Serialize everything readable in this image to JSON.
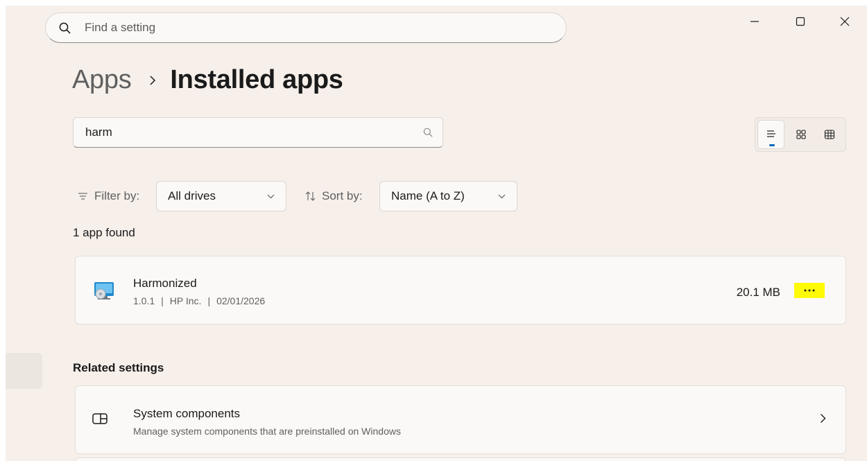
{
  "search": {
    "placeholder": "Find a setting"
  },
  "window_controls": {
    "minimize_icon": "minimize-icon",
    "maximize_icon": "maximize-icon",
    "close_icon": "close-icon"
  },
  "breadcrumb": {
    "parent": "Apps",
    "current": "Installed apps"
  },
  "app_search": {
    "value": "harm",
    "icon": "search-icon"
  },
  "view_toggle": {
    "options": [
      "list-view-icon",
      "tile-view-icon",
      "grid-view-icon"
    ],
    "active": "list-view-icon",
    "accent": "#0067c0"
  },
  "filter": {
    "label": "Filter by:",
    "value": "All drives"
  },
  "sort": {
    "label": "Sort by:",
    "value": "Name (A to Z)"
  },
  "results": {
    "count_text": "1 app found"
  },
  "apps": [
    {
      "name": "Harmonized",
      "version": "1.0.1",
      "publisher": "HP Inc.",
      "date": "02/01/2026",
      "separator": "|",
      "size": "20.1 MB",
      "more_icon": "more-options-icon",
      "highlight_color": "#fffa05"
    }
  ],
  "related": {
    "title": "Related settings",
    "items": [
      {
        "title": "System components",
        "description": "Manage system components that are preinstalled on Windows",
        "icon": "system-components-icon"
      }
    ]
  }
}
